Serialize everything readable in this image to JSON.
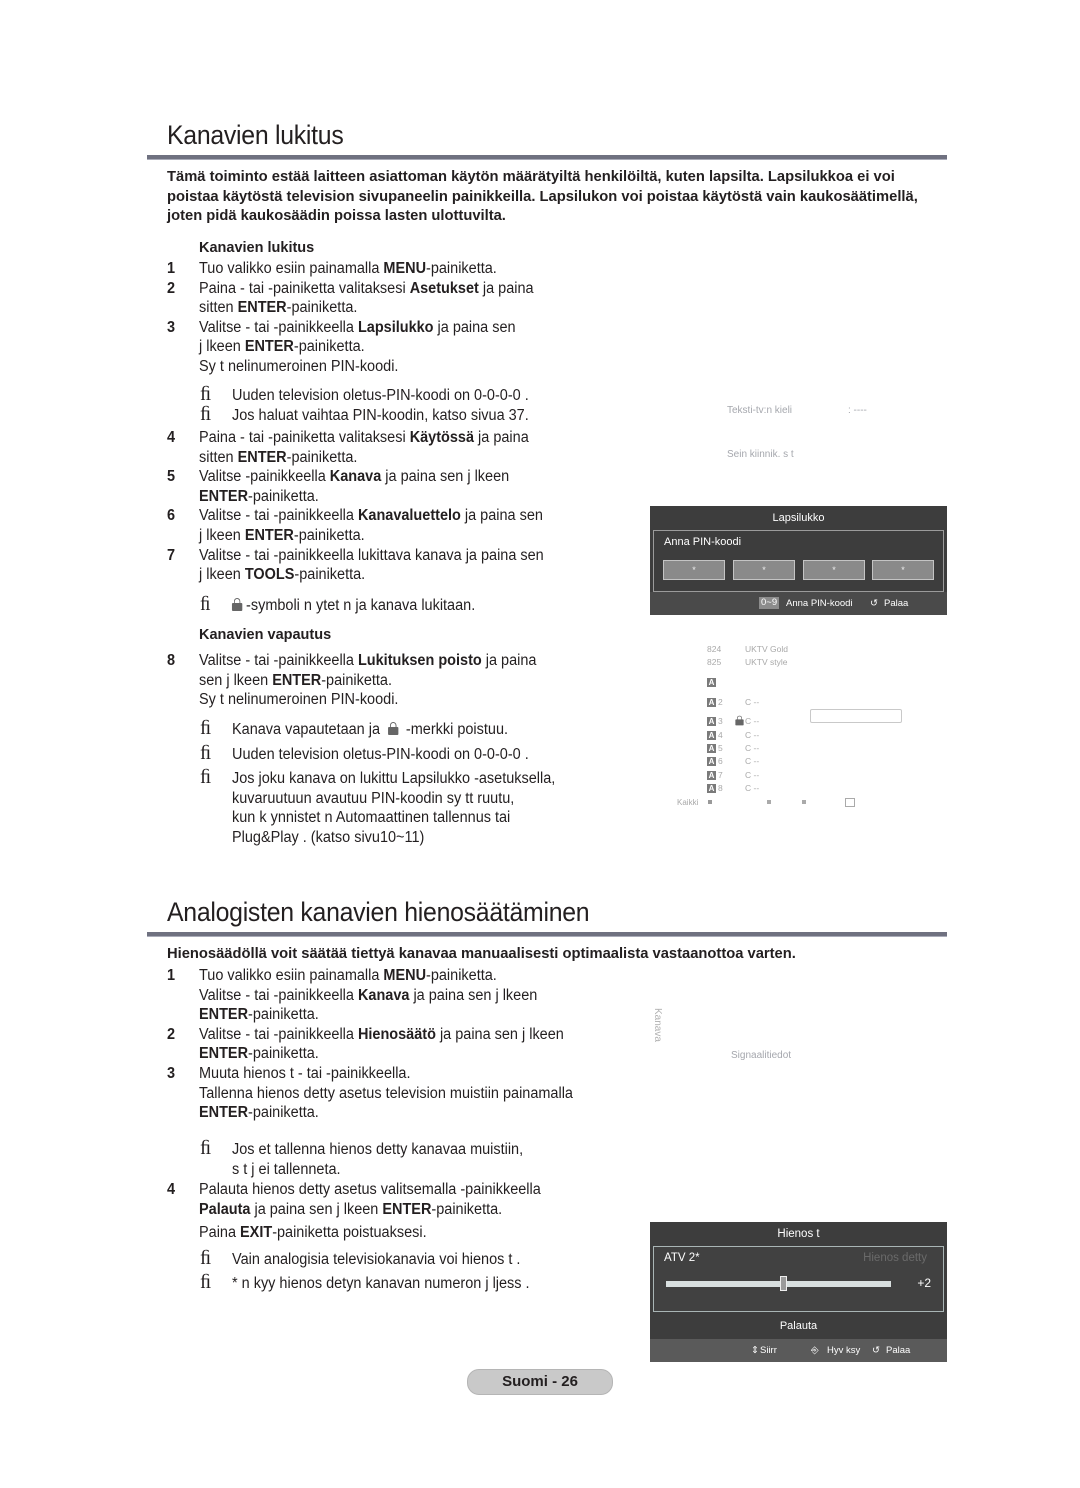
{
  "section1": {
    "title": "Kanavien lukitus",
    "intro": "Tämä toiminto estää laitteen asiattoman käytön määrätyiltä henkilöiltä, kuten lapsilta. Lapsilukkoa ei voi poistaa käytöstä television sivupaneelin painikkeilla. Lapsilukon voi poistaa käytöstä vain kaukosäätimellä, joten pidä kaukosäädin poissa lasten ulottuvilta.",
    "subheading_lock": "Kanavien lukitus",
    "steps": [
      {
        "num": "1",
        "lines": [
          [
            "Tuo valikko esiin painamalla ",
            {
              "b": "MENU"
            },
            "-painiketta."
          ]
        ]
      },
      {
        "num": "2",
        "lines": [
          [
            "Paina  - tai  -painiketta valitaksesi      ",
            {
              "b": "Asetukset"
            },
            " ja paina"
          ],
          [
            "sitten ",
            {
              "b": "ENTER"
            },
            "-painiketta."
          ]
        ]
      },
      {
        "num": "3",
        "lines": [
          [
            "Valitse  - tai  -painikkeella      ",
            {
              "b": "Lapsilukko"
            },
            " ja paina sen"
          ],
          [
            "j lkeen  ",
            {
              "b": "ENTER"
            },
            "-painiketta."
          ],
          [
            "Sy t  nelinumeroinen PIN-koodi."
          ]
        ]
      },
      {
        "num": "4",
        "lines": [
          [
            "Paina  - tai  -painiketta valitaksesi      ",
            {
              "b": "Käytössä"
            },
            " ja paina"
          ],
          [
            "sitten ",
            {
              "b": "ENTER"
            },
            "-painiketta."
          ]
        ]
      },
      {
        "num": "5",
        "lines": [
          [
            "Valitse  -painikkeella   ",
            {
              "b": "Kanava"
            },
            " ja paina sen j lkeen"
          ],
          [
            {
              "b": "ENTER"
            },
            "-painiketta."
          ]
        ]
      },
      {
        "num": "6",
        "lines": [
          [
            "Valitse  - tai  -painikkeella      ",
            {
              "b": "Kanavaluettelo"
            },
            " ja paina sen"
          ],
          [
            "j lkeen  ",
            {
              "b": "ENTER"
            },
            "-painiketta."
          ]
        ]
      },
      {
        "num": "7",
        "lines": [
          [
            "Valitse  - tai  -painikkeella lukittava kanava ja paina sen"
          ],
          [
            "j lkeen  ",
            {
              "b": "TOOLS"
            },
            "-painiketta."
          ]
        ]
      }
    ],
    "notes_after_3": [
      "Uuden television oletus-PIN-koodi on  0-0-0-0 .",
      "Jos haluat vaihtaa PIN-koodin, katso sivua 37."
    ],
    "note_after_7": "-symboli n ytet  n ja kanava lukitaan.",
    "subheading_unlock": "Kanavien vapautus",
    "step8": {
      "num": "8",
      "lines": [
        [
          "Valitse  - tai  -painikkeella      ",
          {
            "b": "Lukituksen poisto"
          },
          " ja paina"
        ],
        [
          "sen j lkeen  ",
          {
            "b": "ENTER"
          },
          "-painiketta."
        ],
        [
          "Sy t  nelinumeroinen PIN-koodi."
        ]
      ]
    },
    "notes_after_8": [
      {
        "pre": "Kanava vapautetaan ja ",
        "post": " -merkki poistuu."
      },
      {
        "text": "Uuden television oletus-PIN-koodi on  0-0-0-0 ."
      },
      {
        "lines": [
          "Jos joku kanava on lukittu  Lapsilukko -asetuksella,",
          "kuvaruutuun avautuu PIN-koodin sy tt ruutu,",
          "kun k ynnistet  n  Automaattinen tallennus  tai",
          " Plug&Play . (katso sivu10~11)"
        ]
      }
    ],
    "note_mark": "ﬁ"
  },
  "osd_setup": {
    "teletext_label": "Teksti-tv:n kieli",
    "teletext_value": ": ----",
    "wall_mount_label": "Sein kiinnik. s  t"
  },
  "osd_pin": {
    "title": "Lapsilukko",
    "prompt": "Anna PIN-koodi",
    "digits": [
      "*",
      "*",
      "*",
      "*"
    ],
    "hint_key": "0~9",
    "hint_label": "Anna PIN-koodi",
    "return_label": "Palaa"
  },
  "osd_channel_list": {
    "rows_top": [
      {
        "num": "824",
        "name": "UKTV Gold"
      },
      {
        "num": "825",
        "name": "UKTV style"
      }
    ],
    "rows": [
      {
        "badge": "A",
        "num": "2",
        "name": "C --",
        "locked": false
      },
      {
        "badge": "A",
        "num": "3",
        "name": "C --",
        "locked": true
      },
      {
        "badge": "A",
        "num": "4",
        "name": "C --",
        "locked": false
      },
      {
        "badge": "A",
        "num": "5",
        "name": "C --",
        "locked": false
      },
      {
        "badge": "A",
        "num": "6",
        "name": "C --",
        "locked": false
      },
      {
        "badge": "A",
        "num": "7",
        "name": "C --",
        "locked": false
      },
      {
        "badge": "A",
        "num": "8",
        "name": "C --",
        "locked": false
      }
    ],
    "all_label": "Kaikki",
    "badge_solo": "A"
  },
  "section2": {
    "title": "Analogisten kanavien hienosäätäminen",
    "intro": "Hienosäädöllä voit säätää tiettyä kanavaa manuaalisesti optimaalista vastaanottoa varten.",
    "steps": [
      {
        "num": "1",
        "lines": [
          [
            "Tuo valikko esiin painamalla ",
            {
              "b": "MENU"
            },
            "-painiketta."
          ],
          [
            "Valitse  - tai  -painikkeella      ",
            {
              "b": "Kanava"
            },
            " ja paina sen j lkeen"
          ],
          [
            {
              "b": "ENTER"
            },
            "-painiketta."
          ]
        ]
      },
      {
        "num": "2",
        "lines": [
          [
            "Valitse  - tai  -painikkeella      ",
            {
              "b": "Hienosäätö"
            },
            " ja paina sen j lkeen"
          ],
          [
            {
              "b": "ENTER"
            },
            "-painiketta."
          ]
        ]
      },
      {
        "num": "3",
        "lines": [
          [
            "Muuta hienos  t    - tai  -painikkeella."
          ],
          [
            "Tallenna hienos  detty asetus television muistiin painamalla"
          ],
          [
            {
              "b": "ENTER"
            },
            "-painiketta."
          ]
        ]
      },
      {
        "num": "4",
        "lines": [
          [
            "Palauta hienos  detty asetus valitsemalla  -painikkeella"
          ],
          [
            {
              "b": "Palauta"
            },
            " ja paina sen j lkeen  ",
            {
              "b": "ENTER"
            },
            "-painiketta."
          ]
        ]
      }
    ],
    "note_after_3": [
      "Jos et tallenna hienos  detty  kanavaa muistiin,",
      "s  t j  ei tallenneta."
    ],
    "exit_line": [
      [
        "Paina ",
        {
          "b": "EXIT"
        },
        "-painiketta poistuaksesi."
      ]
    ],
    "notes_end": [
      "Vain analogisia televisiokanavia voi hienos  t  .",
      " *   n kyy hienos  detyn kanavan numeron j ljess ."
    ]
  },
  "osd_channel_menu": {
    "side_label": "Kanava",
    "signal_label": "Signaalitiedot"
  },
  "osd_finetune": {
    "title": "Hienos  t",
    "channel": "ATV 2*",
    "status": "Hienos  detty",
    "value_label": "+2",
    "value": 2,
    "range": [
      -50,
      50
    ],
    "reset_label": "Palauta",
    "move_label": "Siirr",
    "enter_label": "Hyv ksy",
    "return_label": "Palaa"
  },
  "footer": {
    "page_label": "Suomi - 26"
  }
}
